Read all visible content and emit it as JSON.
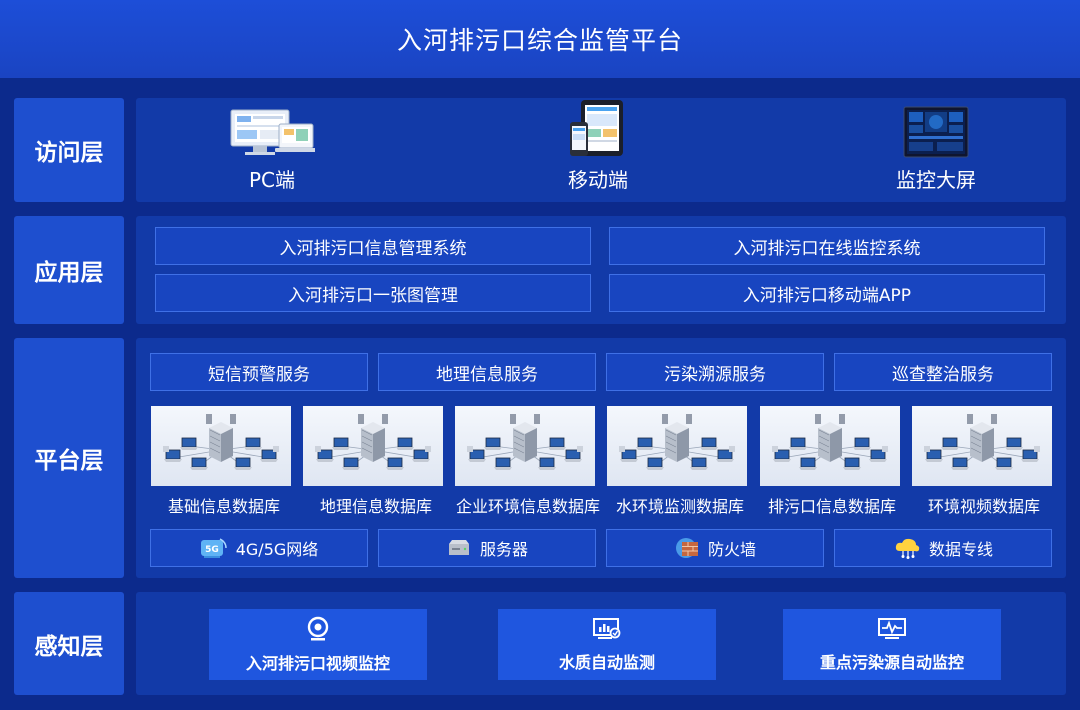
{
  "header": {
    "title": "入河排污口综合监管平台"
  },
  "layers": {
    "access": {
      "label": "访问层"
    },
    "application": {
      "label": "应用层"
    },
    "platform": {
      "label": "平台层"
    },
    "perception": {
      "label": "感知层"
    }
  },
  "access": {
    "items": [
      {
        "label": "PC端",
        "icon": "pc-devices-icon"
      },
      {
        "label": "移动端",
        "icon": "tablet-phone-icon"
      },
      {
        "label": "监控大屏",
        "icon": "monitor-screen-icon"
      }
    ]
  },
  "application": {
    "systems": [
      "入河排污口信息管理系统",
      "入河排污口在线监控系统",
      "入河排污口一张图管理",
      "入河排污口移动端APP"
    ]
  },
  "platform": {
    "services": [
      "短信预警服务",
      "地理信息服务",
      "污染溯源服务",
      "巡查整治服务"
    ],
    "databases": [
      "基础信息数据库",
      "地理信息数据库",
      "企业环境信息数据库",
      "水环境监测数据库",
      "排污口信息数据库",
      "环境视频数据库"
    ],
    "infrastructure": [
      {
        "label": "4G/5G网络",
        "icon": "5g-network-icon"
      },
      {
        "label": "服务器",
        "icon": "server-icon"
      },
      {
        "label": "防火墙",
        "icon": "firewall-icon"
      },
      {
        "label": "数据专线",
        "icon": "cloud-dataline-icon"
      }
    ]
  },
  "perception": {
    "items": [
      {
        "label": "入河排污口视频监控",
        "icon": "camera-icon"
      },
      {
        "label": "水质自动监测",
        "icon": "monitor-chart-icon"
      },
      {
        "label": "重点污染源自动监控",
        "icon": "pulse-screen-icon"
      }
    ]
  }
}
